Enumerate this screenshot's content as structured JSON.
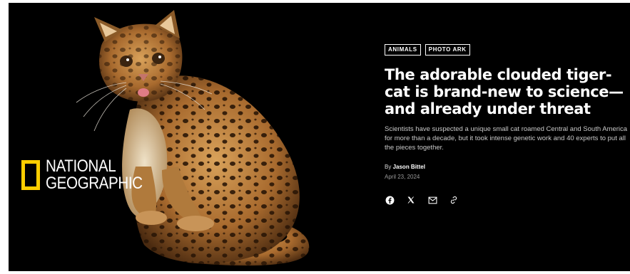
{
  "logo": {
    "line1": "NATIONAL",
    "line2": "GEOGRAPHIC",
    "brand_color": "#FFCE00"
  },
  "article": {
    "tags": [
      "ANIMALS",
      "PHOTO ARK"
    ],
    "headline": "The adorable clouded tiger-cat is brand-new to science—and already under threat",
    "dek": "Scientists have suspected a unique small cat roamed Central and South America for more than a decade, but it took intense genetic work and 40 experts to put all the pieces together.",
    "byline_prefix": "By",
    "author": "Jason Bittel",
    "date": "April 23, 2024"
  },
  "share": {
    "icons": [
      "facebook-icon",
      "x-icon",
      "email-icon",
      "link-icon"
    ]
  },
  "colors": {
    "background": "#000000",
    "text": "#ffffff"
  }
}
